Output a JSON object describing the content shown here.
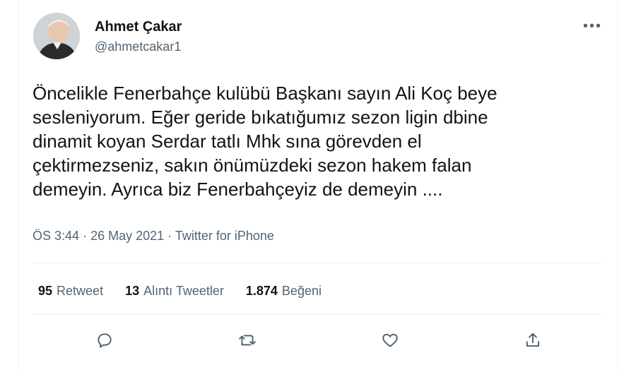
{
  "author": {
    "name": "Ahmet Çakar",
    "handle": "@ahmetcakar1"
  },
  "tweet": {
    "lines": [
      "Öncelikle Fenerbahçe kulübü Başkanı sayın Ali Koç beye",
      "sesleniyorum. Eğer geride bıkatığumız sezon ligin dbine",
      "dinamit koyan Serdar tatlı Mhk sına görevden el",
      "çektirmezseniz, sakın önümüzdeki sezon hakem falan",
      "demeyin. Ayrıca biz Fenerbahçeyiz de demeyin ...."
    ],
    "time": "ÖS 3:44",
    "separator": "·",
    "date": "26 May 2021",
    "source": "Twitter for iPhone"
  },
  "stats": {
    "retweets_count": "95",
    "retweets_label": "Retweet",
    "quotes_count": "13",
    "quotes_label": "Alıntı Tweetler",
    "likes_count": "1.874",
    "likes_label": "Beğeni"
  },
  "icons": {
    "more": "more-icon",
    "reply": "reply-icon",
    "retweet": "retweet-icon",
    "like": "heart-icon",
    "share": "share-icon"
  },
  "colors": {
    "text": "#0f1419",
    "secondary": "#536471",
    "divider": "#e6ecf0"
  }
}
